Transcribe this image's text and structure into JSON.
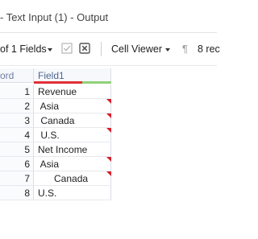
{
  "window": {
    "title": "- Text Input (1) - Output"
  },
  "toolbar": {
    "fields_selector": "of 1 Fields",
    "viewer_selector": "Cell Viewer",
    "pilcrow_symbol": "¶",
    "records_count": "8 rec"
  },
  "grid": {
    "record_header": "ord",
    "field_header": "Field1",
    "rows": [
      {
        "record": "1",
        "value": "Revenue",
        "flagged": false
      },
      {
        "record": "2",
        "value": " Asia",
        "flagged": true
      },
      {
        "record": "3",
        "value": " Canada",
        "flagged": true
      },
      {
        "record": "4",
        "value": " U.S.",
        "flagged": true
      },
      {
        "record": "5",
        "value": "Net Income",
        "flagged": false
      },
      {
        "record": "6",
        "value": " Asia",
        "flagged": true
      },
      {
        "record": "7",
        "value": "      Canada",
        "flagged": true
      },
      {
        "record": "8",
        "value": "U.S.",
        "flagged": false
      }
    ]
  },
  "colors": {
    "header_text": "#4f6690",
    "flag_red": "#d81e2b",
    "header_bar_red": "#e0303a",
    "header_bar_green": "#8fd27a"
  },
  "icons": [
    "checkbox-icon",
    "close-box-icon",
    "pilcrow-icon",
    "chevron-down-icon"
  ]
}
